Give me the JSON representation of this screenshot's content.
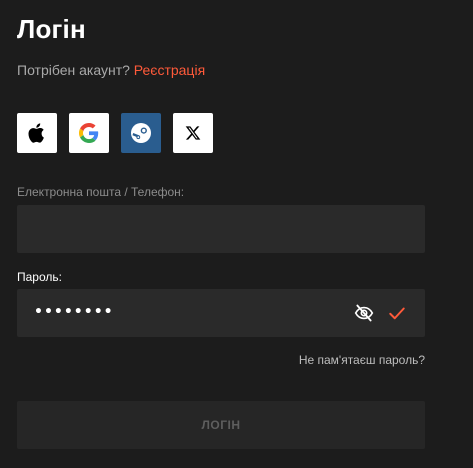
{
  "page": {
    "title": "Логін",
    "signup_prompt": "Потрібен акаунт?",
    "signup_link": "Реєстрація"
  },
  "social": [
    {
      "name": "apple",
      "icon": "apple-icon"
    },
    {
      "name": "google",
      "icon": "google-icon"
    },
    {
      "name": "steam",
      "icon": "steam-icon"
    },
    {
      "name": "x",
      "icon": "x-icon"
    }
  ],
  "form": {
    "email_label": "Електронна пошта / Телефон:",
    "email_value": "",
    "password_label": "Пароль:",
    "password_masked": "••••••••",
    "forgot_link": "Не пам'ятаєш пароль?",
    "submit_label": "ЛОГІН"
  },
  "colors": {
    "background": "#1c1c1c",
    "input_bg": "#2a2a2a",
    "accent": "#ff5a3a",
    "steam_bg": "#2a5d8f"
  }
}
